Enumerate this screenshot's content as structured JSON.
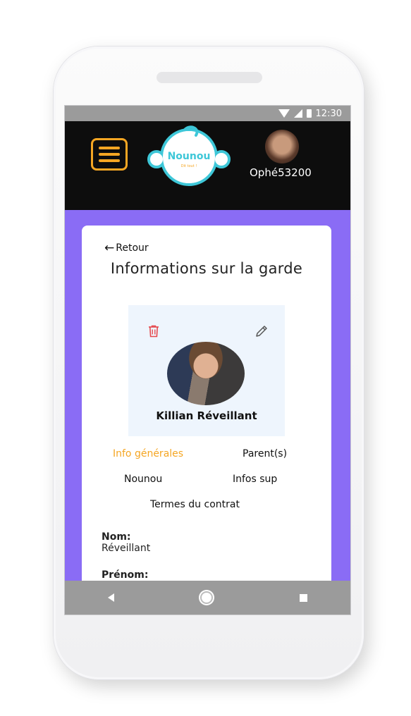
{
  "status_bar": {
    "time": "12:30"
  },
  "app_bar": {
    "logo_text": "Nounou",
    "logo_tagline": "Dit tout !",
    "username": "Ophé53200"
  },
  "page": {
    "back_label": "Retour",
    "title": "Informations sur la garde"
  },
  "profile": {
    "child_name": "Killian Réveillant"
  },
  "tabs": [
    {
      "label": "Info générales",
      "active": true
    },
    {
      "label": "Parent(s)",
      "active": false
    },
    {
      "label": "Nounou",
      "active": false
    },
    {
      "label": "Infos sup",
      "active": false
    },
    {
      "label": "Termes du contrat",
      "active": false
    }
  ],
  "fields": [
    {
      "label": "Nom:",
      "value": "Réveillant"
    },
    {
      "label": "Prénom:",
      "value": ""
    }
  ],
  "colors": {
    "accent": "#f5a623",
    "background": "#8a6cf5",
    "appbar": "#0d0d0d",
    "delete": "#e5484d",
    "logo_cyan": "#3ec7d8"
  }
}
